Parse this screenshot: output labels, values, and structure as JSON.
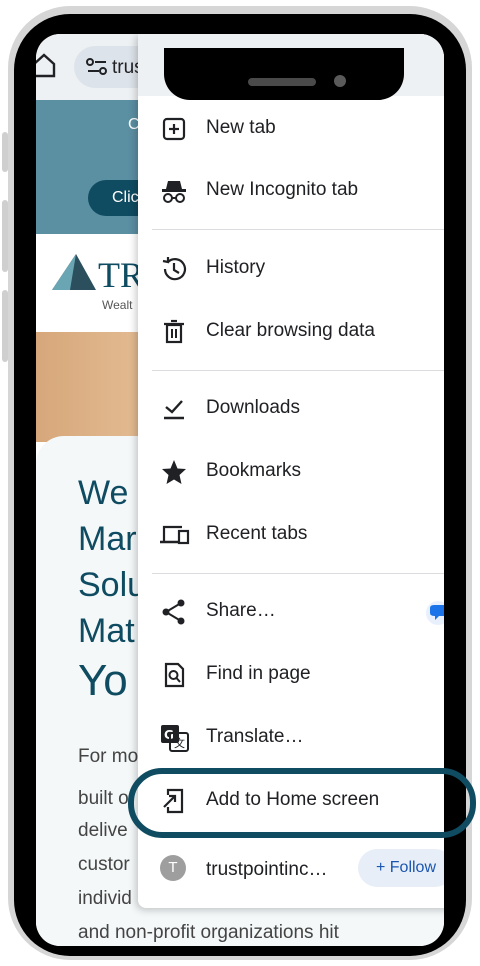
{
  "browser": {
    "url_text": "trus",
    "toolbar_icons": [
      "home-icon",
      "site-info-icon",
      "forward-icon",
      "bookmark-star-icon",
      "download-icon",
      "info-icon",
      "reload-icon"
    ]
  },
  "webpage": {
    "banner_text": "C",
    "banner_button": "Clic",
    "logo_text": "TR",
    "logo_subtitle": "Wealt",
    "hero_lines": [
      "We",
      "Mar",
      "Solu",
      "Mat",
      "Yo"
    ],
    "body_lines": [
      "For mo",
      "built o",
      "delive",
      "custor",
      "individ",
      "and non-profit organizations hit"
    ]
  },
  "menu": {
    "items": [
      {
        "label": "New tab",
        "icon": "new-tab-icon"
      },
      {
        "label": "New Incognito tab",
        "icon": "incognito-icon"
      },
      {
        "label": "History",
        "icon": "history-icon"
      },
      {
        "label": "Clear browsing data",
        "icon": "trash-icon"
      },
      {
        "label": "Downloads",
        "icon": "download-check-icon"
      },
      {
        "label": "Bookmarks",
        "icon": "star-icon"
      },
      {
        "label": "Recent tabs",
        "icon": "devices-icon"
      },
      {
        "label": "Share…",
        "icon": "share-icon"
      },
      {
        "label": "Find in page",
        "icon": "find-in-page-icon"
      },
      {
        "label": "Translate…",
        "icon": "translate-icon"
      },
      {
        "label": "Add to Home screen",
        "icon": "add-to-home-icon"
      }
    ],
    "site": {
      "avatar_letter": "T",
      "name": "trustpointinc…",
      "follow_label": "+ Follow"
    }
  },
  "colors": {
    "brand": "#0f4b61",
    "banner": "#5b8fa2",
    "highlight_ring": "#0f4b61"
  }
}
